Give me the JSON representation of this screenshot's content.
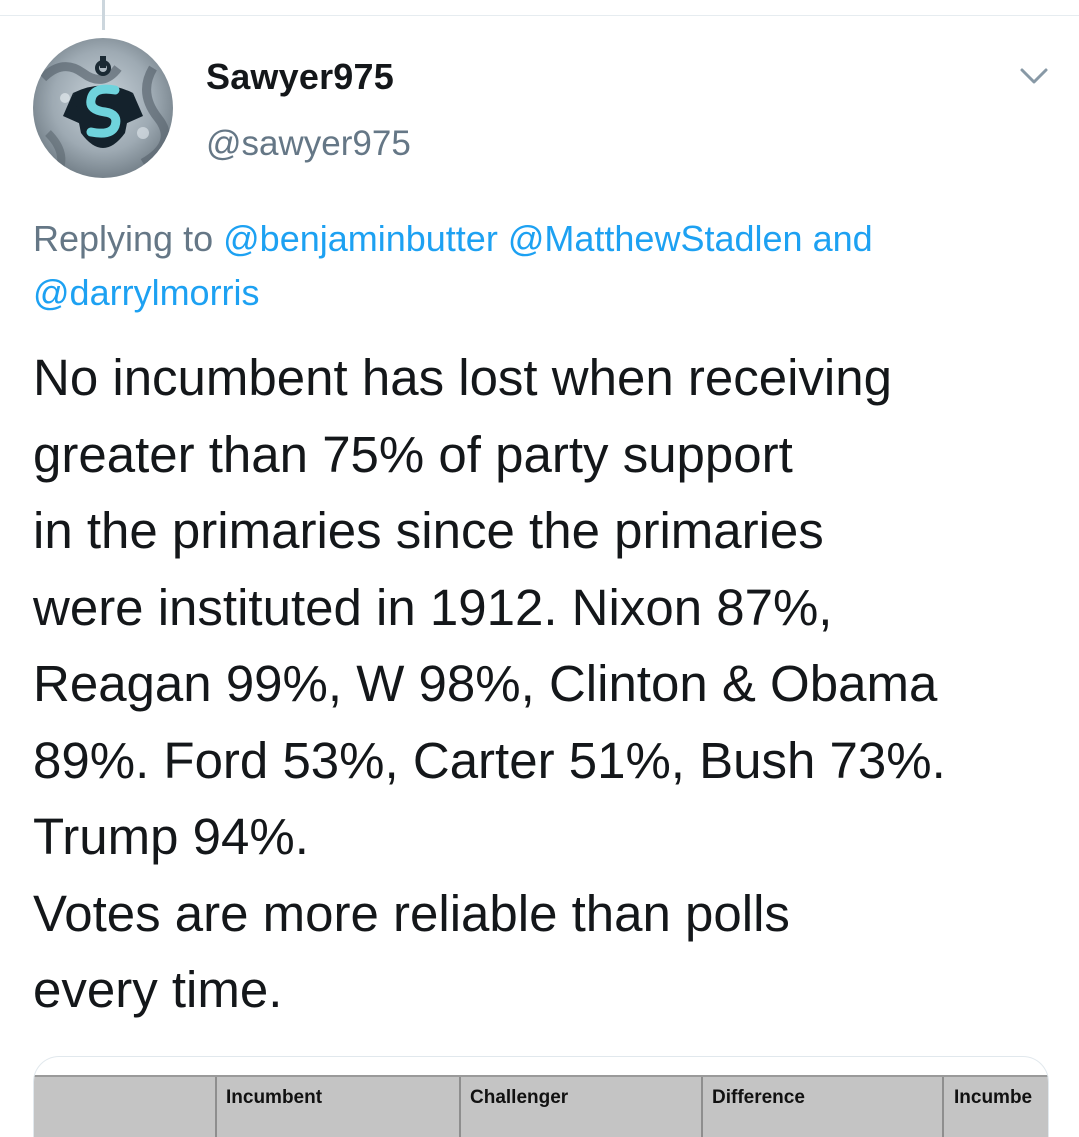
{
  "tweet": {
    "author": {
      "display_name": "Sawyer975",
      "handle": "@sawyer975",
      "avatar_icon": "kraken-anchor-logo-icon"
    },
    "menu_icon": "chevron-down-icon",
    "reply": {
      "prefix": "Replying to",
      "mentions": [
        "@benjaminbutter",
        "@MatthewStadlen"
      ],
      "conjunction": "and",
      "last_mention": "@darrylmorris"
    },
    "text_lines": [
      "No incumbent has lost when receiving",
      "greater than 75% of party support",
      "in the primaries since the primaries",
      "were instituted in 1912. Nixon 87%,",
      "Reagan 99%, W 98%, Clinton & Obama",
      "89%. Ford 53%, Carter 51%, Bush 73%.",
      "Trump 94%.",
      "Votes are more reliable than polls",
      "every time."
    ],
    "media": {
      "table_headers": [
        "Incumbent",
        "Challenger",
        "Difference",
        "Incumbe"
      ]
    }
  },
  "colors": {
    "text_primary": "#14171a",
    "text_secondary": "#657786",
    "link": "#1da1f2",
    "border": "#e6ecf0"
  }
}
